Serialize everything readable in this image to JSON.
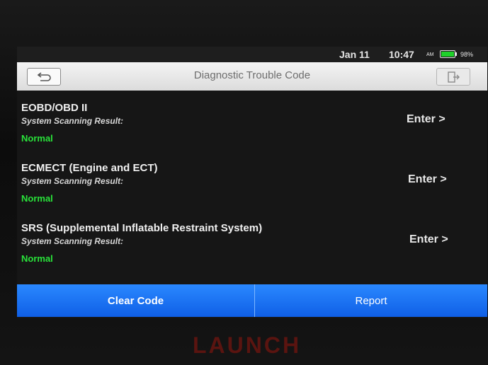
{
  "status_bar": {
    "date": "Jan 11",
    "time": "10:47",
    "ampm": "AM",
    "battery_text": "98%",
    "battery_level": 0.98,
    "battery_color": "#1fd12a"
  },
  "header": {
    "title": "Diagnostic Trouble Code",
    "back_icon": "back-arrow-icon",
    "exit_icon": "exit-icon"
  },
  "systems": [
    {
      "name": "EOBD/OBD II",
      "scan_label": "System Scanning Result:",
      "status": "Normal",
      "enter_label": "Enter >"
    },
    {
      "name": "ECMECT (Engine and ECT)",
      "scan_label": "System Scanning Result:",
      "status": "Normal",
      "enter_label": "Enter >"
    },
    {
      "name": "SRS (Supplemental Inflatable Restraint System)",
      "scan_label": "System Scanning Result:",
      "status": "Normal",
      "enter_label": "Enter >"
    }
  ],
  "footer": {
    "clear_code_label": "Clear Code",
    "report_label": "Report",
    "accent_color": "#1a6ff5"
  },
  "device": {
    "brand": "LAUNCH"
  }
}
